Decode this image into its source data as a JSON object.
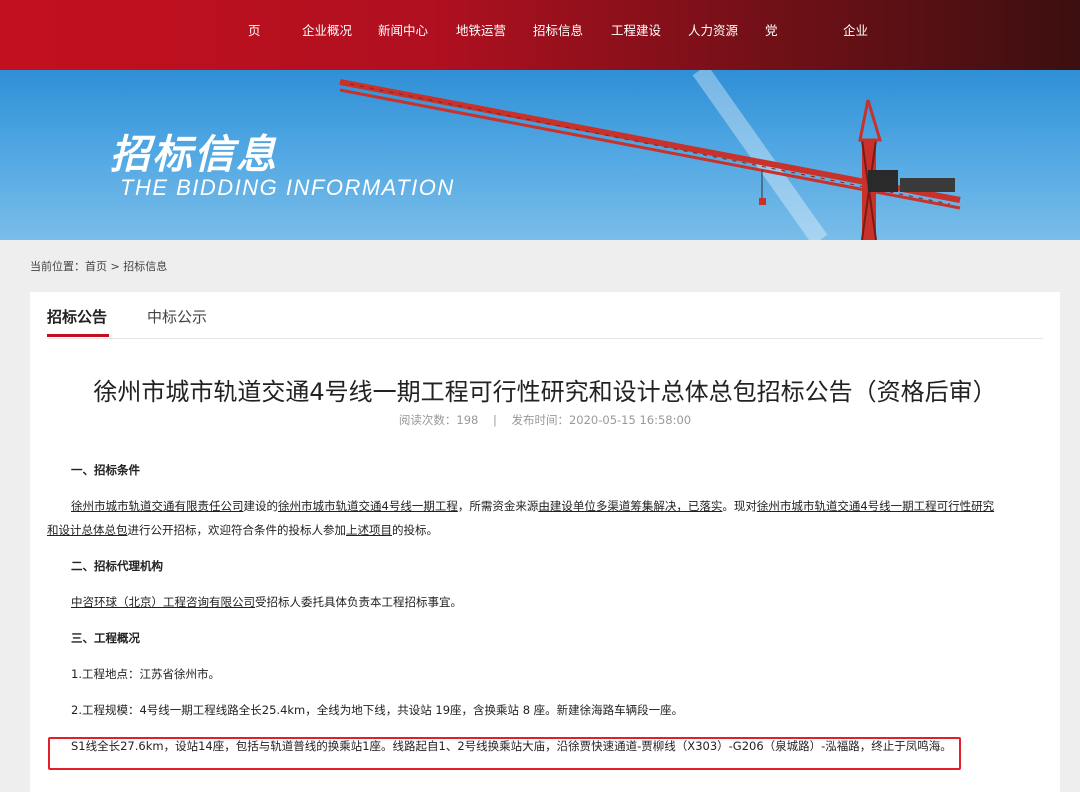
{
  "nav": {
    "items": [
      {
        "label": "页"
      },
      {
        "label": "企业概况"
      },
      {
        "label": "新闻中心"
      },
      {
        "label": "地铁运营"
      },
      {
        "label": "招标信息"
      },
      {
        "label": "工程建设"
      },
      {
        "label": "人力资源"
      },
      {
        "label": "党"
      },
      {
        "label": "企业"
      }
    ]
  },
  "banner": {
    "title_cn": "招标信息",
    "title_en": "THE BIDDING INFORMATION"
  },
  "breadcrumb": {
    "prefix": "当前位置：",
    "home": "首页",
    "sep": " > ",
    "current": "招标信息"
  },
  "tabs": {
    "active": "招标公告",
    "inactive": "中标公示"
  },
  "article": {
    "title": "徐州市城市轨道交通4号线一期工程可行性研究和设计总体总包招标公告（资格后审）",
    "views_label": "阅读次数：",
    "views": "198",
    "meta_sep": "|",
    "date_label": "发布时间：",
    "date": "2020-05-15 16:58:00",
    "h1": "一、招标条件",
    "p1a": "徐州市城市轨道交通有限责任公司",
    "p1b": "建设的",
    "p1c": "徐州市城市轨道交通4号线一期工程",
    "p1d": "，所需资金来源",
    "p1e": "由建设单位多渠道筹集解决，已落实",
    "p1f": "。现对",
    "p1g": "徐州市城市轨道交通4号线一期工程可行性研究",
    "p1h": "和设计总体总包",
    "p1i": "进行公开招标，欢迎符合条件的投标人参加",
    "p1j": "上述项目",
    "p1k": "的投标。",
    "h2": "二、招标代理机构",
    "p2a": "中咨环球（北京）工程咨询有限公司",
    "p2b": "受招标人委托具体负责本工程招标事宜。",
    "h3": "三、工程概况",
    "p3": "1.工程地点：江苏省徐州市。",
    "p4": "2.工程规模：4号线一期工程线路全长25.4km，全线为地下线，共设站 19座，含换乘站 8 座。新建徐海路车辆段一座。",
    "p5": "S1线全长27.6km，设站14座，包括与轨道普线的换乘站1座。线路起自1、2号线换乘站大庙，沿徐贾快速通道-贾柳线（X303）-G206（泉城路）-泓福路，终止于凤鸣海。"
  },
  "colors": {
    "brand_red": "#c3101e",
    "highlight_border": "#e3202a"
  }
}
